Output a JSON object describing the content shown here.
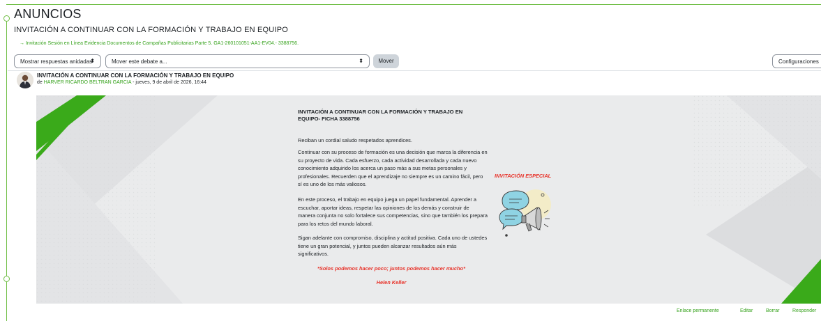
{
  "page": {
    "title": "ANUNCIOS",
    "subtitle": "INVITACIÓN A CONTINUAR CON LA FORMACIÓN Y TRABAJO EN EQUIPO",
    "parent_link": "→ Invitación Sesión en Línea Evidencia Documentos de Campañas Publicitarias Parte 5. GA1-260101051-AA1-EV04.- 3388756."
  },
  "toolbar": {
    "display_mode": "Mostrar respuestas anidadas",
    "move_placeholder": "Mover este debate a...",
    "move_button": "Mover",
    "settings": "Configuraciones"
  },
  "post": {
    "subject": "INVITACIÓN A CONTINUAR CON LA FORMACIÓN Y TRABAJO EN EQUIPO",
    "by_prefix": "de ",
    "author": "HARVER RICARDO BELTRAN GARCIA",
    "date": " - jueves, 9 de abril de 2026, 16:44"
  },
  "banner": {
    "heading": "INVITACIÓN A CONTINUAR CON LA FORMACIÓN Y TRABAJO EN EQUIPO- FICHA 3388756",
    "greeting": "Reciban un cordial saludo respetados aprendices.",
    "p1": "Continuar con su proceso de formación es una decisión que marca la diferencia en su proyecto de vida. Cada esfuerzo, cada actividad desarrollada y cada nuevo conocimiento adquirido los acerca un paso más a sus metas personales y profesionales. Recuerden que el aprendizaje no siempre es un camino fácil, pero sí es uno de los más valiosos.",
    "p2": "En este proceso, el trabajo en equipo juega un papel fundamental. Aprender a escuchar, aportar ideas, respetar las opiniones de los demás y construir de manera conjunta no solo fortalece sus competencias, sino que también los prepara para los retos del mundo laboral.",
    "p3": "Sigan adelante con compromiso, disciplina y actitud positiva. Cada uno de ustedes tiene un gran potencial, y juntos pueden alcanzar resultados aún más significativos.",
    "quote": "*Solos podemos hacer poco; juntos podemos hacer mucho*",
    "quote_author": "Helen Keller",
    "special": "INVITACIÓN ESPECIAL"
  },
  "actions": {
    "permalink": "Enlace permanente",
    "edit": "Editar",
    "delete": "Borrar",
    "reply": "Responder"
  },
  "colors": {
    "accent_green": "#36a21c",
    "banner_green": "#3aaa1a",
    "quote_red": "#e8332a"
  },
  "icons": {
    "select_caret": "⬍",
    "settings_caret": "⌄"
  }
}
